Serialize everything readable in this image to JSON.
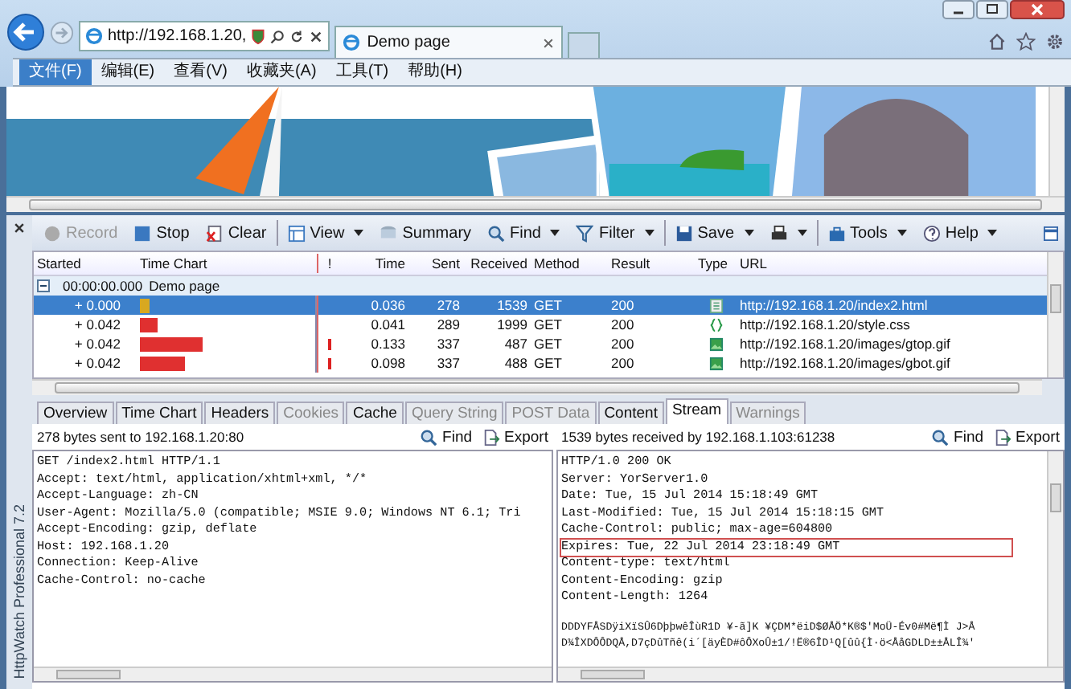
{
  "browser": {
    "address": "http://192.168.1.20,",
    "tab_title": "Demo page"
  },
  "menu": [
    {
      "label": "文件(F)",
      "selected": true
    },
    {
      "label": "编辑(E)",
      "selected": false
    },
    {
      "label": "查看(V)",
      "selected": false
    },
    {
      "label": "收藏夹(A)",
      "selected": false
    },
    {
      "label": "工具(T)",
      "selected": false
    },
    {
      "label": "帮助(H)",
      "selected": false
    }
  ],
  "httpwatch": {
    "side_label": "HttpWatch Professional 7.2",
    "toolbar": [
      {
        "kind": "record",
        "label": "Record",
        "disabled": true,
        "dropdown": false
      },
      {
        "kind": "stop",
        "label": "Stop",
        "disabled": false,
        "dropdown": false
      },
      {
        "kind": "clear",
        "label": "Clear",
        "disabled": false,
        "dropdown": false
      },
      {
        "kind": "view",
        "label": "View",
        "disabled": false,
        "dropdown": true
      },
      {
        "kind": "summary",
        "label": "Summary",
        "disabled": false,
        "dropdown": false
      },
      {
        "kind": "find",
        "label": "Find",
        "disabled": false,
        "dropdown": true
      },
      {
        "kind": "filter",
        "label": "Filter",
        "disabled": false,
        "dropdown": true
      },
      {
        "kind": "save",
        "label": "Save",
        "disabled": false,
        "dropdown": true
      },
      {
        "kind": "print",
        "disabled": false,
        "dropdown": true
      },
      {
        "kind": "tools",
        "label": "Tools",
        "disabled": false,
        "dropdown": true
      },
      {
        "kind": "help",
        "label": "Help",
        "disabled": false,
        "dropdown": true
      }
    ],
    "table": {
      "columns": [
        "Started",
        "Time Chart",
        "!",
        "Time",
        "Sent",
        "Received",
        "Method",
        "Result",
        "Type",
        "URL"
      ],
      "group": {
        "started": "00:00:00.000",
        "title": "Demo page",
        "expanded": true
      },
      "rows": [
        {
          "started": "+ 0.000",
          "color": "#d8a820",
          "level": 0.06,
          "warning": false,
          "time": "0.036",
          "sent": "278",
          "received": "1539",
          "method": "GET",
          "result": "200",
          "kind": "html",
          "url": "http://192.168.1.20/index2.html",
          "selected": true
        },
        {
          "started": "+ 0.042",
          "color": "#e03030",
          "level": 0.1,
          "warning": false,
          "time": "0.041",
          "sent": "289",
          "received": "1999",
          "method": "GET",
          "result": "200",
          "kind": "css",
          "url": "http://192.168.1.20/style.css",
          "selected": false
        },
        {
          "started": "+ 0.042",
          "color": "#e03030",
          "level": 0.36,
          "warning": true,
          "time": "0.133",
          "sent": "337",
          "received": "487",
          "method": "GET",
          "result": "200",
          "kind": "image",
          "url": "http://192.168.1.20/images/gtop.gif",
          "selected": false
        },
        {
          "started": "+ 0.042",
          "color": "#e03030",
          "level": 0.26,
          "warning": true,
          "time": "0.098",
          "sent": "337",
          "received": "488",
          "method": "GET",
          "result": "200",
          "kind": "image",
          "url": "http://192.168.1.20/images/gbot.gif",
          "selected": false
        }
      ]
    },
    "tabs": [
      {
        "label": "Overview",
        "selected": false,
        "disabled": false
      },
      {
        "label": "Time Chart",
        "selected": false,
        "disabled": false
      },
      {
        "label": "Headers",
        "selected": false,
        "disabled": false
      },
      {
        "label": "Cookies",
        "selected": false,
        "disabled": true
      },
      {
        "label": "Cache",
        "selected": false,
        "disabled": false
      },
      {
        "label": "Query String",
        "selected": false,
        "disabled": true
      },
      {
        "label": "POST Data",
        "selected": false,
        "disabled": true
      },
      {
        "label": "Content",
        "selected": false,
        "disabled": false
      },
      {
        "label": "Stream",
        "selected": true,
        "disabled": false
      },
      {
        "label": "Warnings",
        "selected": false,
        "disabled": true
      }
    ],
    "request": {
      "summary": "278 bytes sent to 192.168.1.20:80",
      "find": "Find",
      "export": "Export",
      "lines": [
        {
          "text": "GET /index2.html HTTP/1.1",
          "highlighted": false
        },
        {
          "text": "Accept: text/html, application/xhtml+xml, */*",
          "highlighted": false
        },
        {
          "text": "Accept-Language: zh-CN",
          "highlighted": false
        },
        {
          "text": "User-Agent: Mozilla/5.0 (compatible; MSIE 9.0; Windows NT 6.1; Tri",
          "highlighted": false
        },
        {
          "text": "Accept-Encoding: gzip, deflate",
          "highlighted": false
        },
        {
          "text": "Host: 192.168.1.20",
          "highlighted": false
        },
        {
          "text": "Connection: Keep-Alive",
          "highlighted": false
        },
        {
          "text": "Cache-Control: no-cache",
          "highlighted": false
        }
      ]
    },
    "response": {
      "summary": "1539 bytes received by 192.168.1.103:61238",
      "find": "Find",
      "export": "Export",
      "lines": [
        {
          "text": "HTTP/1.0 200 OK",
          "highlighted": false
        },
        {
          "text": "Server: YorServer1.0",
          "highlighted": false
        },
        {
          "text": "Date: Tue, 15 Jul 2014 15:18:49 GMT",
          "highlighted": false
        },
        {
          "text": "Last-Modified: Tue, 15 Jul 2014 15:18:15 GMT",
          "highlighted": false
        },
        {
          "text": "Cache-Control: public; max-age=604800",
          "highlighted": false
        },
        {
          "text": "Expires: Tue, 22 Jul 2014 23:18:49 GMT",
          "highlighted": true
        },
        {
          "text": "Content-type: text/html",
          "highlighted": false
        },
        {
          "text": "Content-Encoding: gzip",
          "highlighted": false
        },
        {
          "text": "Content-Length: 1264",
          "highlighted": false
        }
      ],
      "body_lines": [
        "DDDYFÅSDÿiXïSÛ6DþþwêÎùR1D ¥-ã]K ¥ÇDM*ëiD$ØÅÖ*K®$'MoÜ-Év0#Më¶Ì J>Å",
        "D¾ÎXDÔÔDQÅ,D7çDûTñê(i´[äyÈD#ôÔXoÛ±1/!Ë®6ÎD¹Q[ûû{Ì·ö<ÅåGDLD±±ÅLÎ¾'"
      ]
    }
  }
}
